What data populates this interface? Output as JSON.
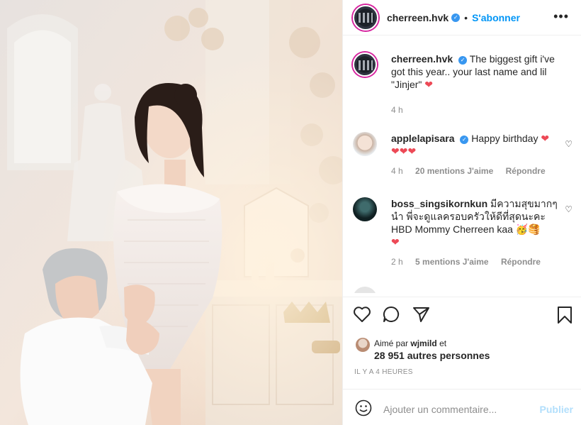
{
  "post": {
    "username": "cherreen.hvk",
    "follow_label": "S'abonner",
    "more_icon": "more-options-icon",
    "caption": "The biggest gift i've got this year.. your last name and lil \"Jinjer\"",
    "caption_time": "4 h"
  },
  "comments": [
    {
      "username": "applelapisara",
      "text": "Happy birthday",
      "time": "4 h",
      "likes": "20 mentions J'aime",
      "reply": "Répondre"
    },
    {
      "username": "boss_singsikornkun",
      "text": "มีความสุขมากๆนำ พี่จะดูแลครอบครัวให้ดีที่สุดนะคะ HBD Mommy Cherreen kaa",
      "time": "2 h",
      "likes": "5 mentions J'aime",
      "reply": "Répondre"
    }
  ],
  "actions": {
    "like_icon": "heart-icon",
    "comment_icon": "comment-icon",
    "share_icon": "share-icon",
    "save_icon": "bookmark-icon"
  },
  "likes": {
    "liked_by_prefix": "Aimé par",
    "liked_by_user": "wjmild",
    "liked_by_suffix": "et",
    "others": "28 951 autres personnes"
  },
  "timestamp": "IL Y A 4 HEURES",
  "comment_input": {
    "placeholder": "Ajouter un commentaire...",
    "post_label": "Publier"
  },
  "colors": {
    "accent": "#0095f6",
    "heart": "#ed4956",
    "muted": "#8e8e8e"
  }
}
